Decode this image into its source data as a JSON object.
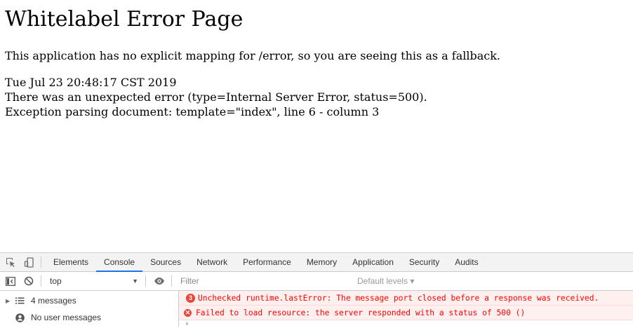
{
  "page": {
    "title": "Whitelabel Error Page",
    "intro": "This application has no explicit mapping for /error, so you are seeing this as a fallback.",
    "timestamp": "Tue Jul 23 20:48:17 CST 2019",
    "error_line": "There was an unexpected error (type=Internal Server Error, status=500).",
    "exception_line": "Exception parsing document: template=\"index\", line 6 - column 3"
  },
  "devtools": {
    "tabs": [
      "Elements",
      "Console",
      "Sources",
      "Network",
      "Performance",
      "Memory",
      "Application",
      "Security",
      "Audits"
    ],
    "active_tab": "Console",
    "context": "top",
    "filter_placeholder": "Filter",
    "levels_label": "Default levels ▾",
    "sidebar": {
      "messages_label": "4 messages",
      "user_messages_label": "No user messages"
    },
    "messages": [
      {
        "count": "3",
        "text": "Unchecked runtime.lastError: The message port closed before a response was received."
      },
      {
        "text": "Failed to load resource: the server responded with a status of 500 ()"
      }
    ],
    "colors": {
      "error": "#fe0000",
      "error_bg": "#fff0f0",
      "accent": "#1a73e8"
    }
  }
}
